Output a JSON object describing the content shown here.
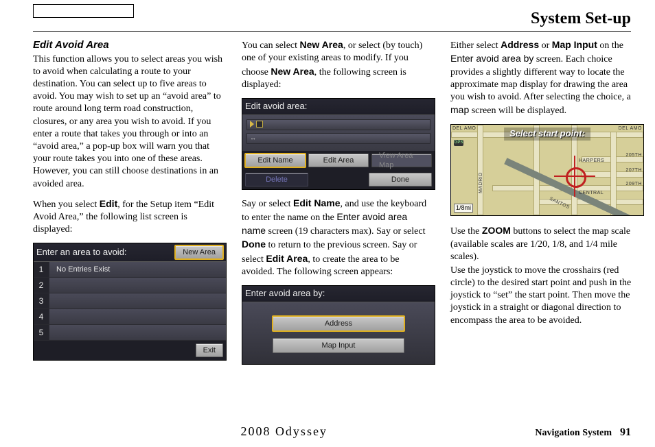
{
  "page_title": "System Set-up",
  "heading": "Edit Avoid Area",
  "col1": {
    "p1a": "This function allows you to select areas you wish to avoid when calculating a route to your destination. You can select up to five areas to avoid. You may wish to set up an “avoid area” to route around long term road construction, closures, or any area you wish to avoid. If you enter a route that takes you through or into an “avoid area,” a pop-up box will warn you that your route takes you into one of these areas. However, you can still choose destinations in an avoided area.",
    "p2_pre": "When you select ",
    "p2_bold": "Edit",
    "p2_post": ", for the Setup item “Edit Avoid Area,” the following list screen is displayed:"
  },
  "screen1": {
    "title": "Enter an area to avoid:",
    "new_area": "New Area",
    "rows": [
      "1",
      "2",
      "3",
      "4",
      "5"
    ],
    "empty": "No Entries Exist",
    "exit": "Exit"
  },
  "col2": {
    "p1a": "You can select ",
    "p1b": "New Area",
    "p1c": ", or select (by touch) one of your existing areas to modify. If you choose ",
    "p1d": "New Area",
    "p1e": ", the following screen is displayed:"
  },
  "screen2": {
    "title": "Edit avoid area:",
    "edit_name": "Edit Name",
    "edit_area": "Edit Area",
    "view_map": "View Area Map",
    "delete": "Delete",
    "done": "Done"
  },
  "col2b": {
    "t1": "Say or select ",
    "b1": "Edit Name",
    "t2": ", and use the keyboard to enter the name on the ",
    "s1": "Enter avoid area name",
    "t3": " screen (19 characters max). Say or select ",
    "b2": "Done",
    "t4": " to return to the previous screen. Say or select ",
    "b3": "Edit Area",
    "t5": ", to create the area to be avoided. The following screen appears:"
  },
  "screen3": {
    "title": "Enter avoid area by:",
    "address": "Address",
    "map": "Map Input"
  },
  "col3": {
    "p1a": "Either select ",
    "p1b1": "Address",
    "p1mid": " or ",
    "p1b2": "Map Input",
    "p1c": " on the ",
    "p1s": "Enter avoid area by",
    "p1d": " screen. Each choice provides a slightly different way to locate the approximate map display for drawing the area you wish to avoid. After selecting the choice, a ",
    "p1s2": "map",
    "p1e": " screen will be displayed."
  },
  "map": {
    "banner": "Select start point:",
    "scale": "1/8mi",
    "gps": "GPS",
    "labels": {
      "delamo_l": "DEL AMO",
      "delamo_r": "DEL AMO",
      "r205": "205TH",
      "r207": "207TH",
      "r209": "209TH",
      "harpers": "HARPERS",
      "central": "CENTRAL",
      "madrid": "MADRID",
      "santos": "SANTOS"
    }
  },
  "col3b": {
    "t1": "Use the ",
    "b1": "ZOOM",
    "t2": " buttons to select the map scale (available scales are 1/20, 1/8, and 1/4 mile scales).",
    "t3": "Use the joystick to move the crosshairs (red circle) to the desired start point and push in the joystick to “set” the start point. Then move the joystick in a straight or diagonal direction to encompass the area to be avoided."
  },
  "footer": {
    "model": "2008  Odyssey",
    "label": "Navigation System",
    "page": "91"
  }
}
